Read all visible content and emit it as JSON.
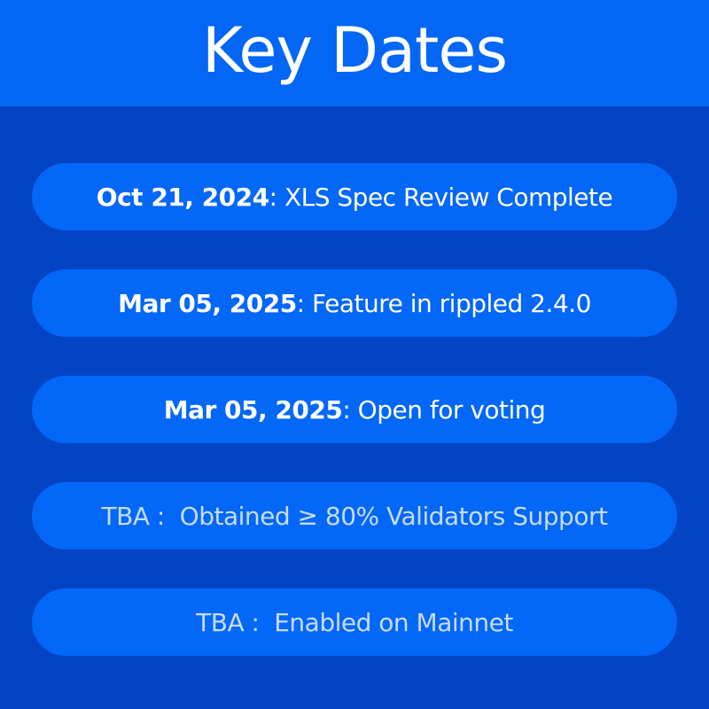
{
  "header": {
    "title": "Key Dates"
  },
  "milestones": [
    {
      "date": "Oct 21, 2024",
      "separator": ": ",
      "label": "XLS Spec Review Complete",
      "status": "done"
    },
    {
      "date": "Mar 05, 2025",
      "separator": ": ",
      "label": "Feature in rippled 2.4.0",
      "status": "done"
    },
    {
      "date": "Mar 05, 2025",
      "separator": ": ",
      "label": "Open for voting",
      "status": "done"
    },
    {
      "date": "TBA",
      "separator": " :  ",
      "label": "Obtained ≥ 80% Validators Support",
      "status": "pending"
    },
    {
      "date": "TBA",
      "separator": " :  ",
      "label": "Enabled on Mainnet",
      "status": "pending"
    }
  ],
  "colors": {
    "background": "#0344c4",
    "header": "#0366f5",
    "pill": "#0367f7",
    "text": "#ffffff",
    "pending_text": "#c6dcfb"
  }
}
